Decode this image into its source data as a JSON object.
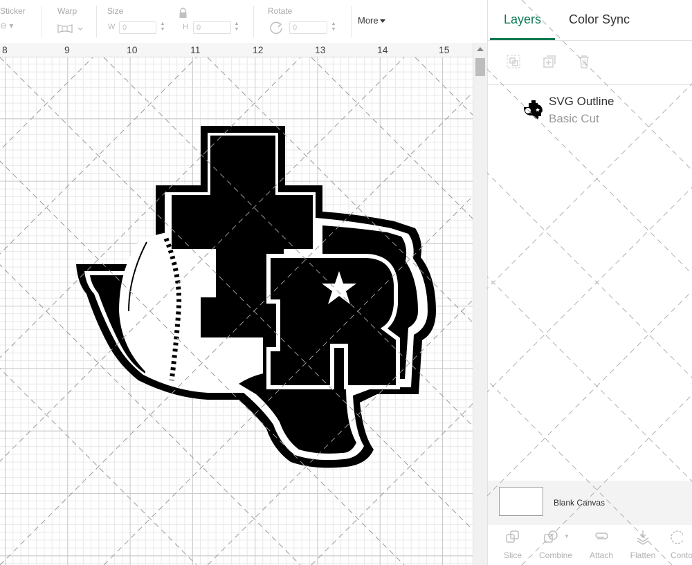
{
  "toolbar": {
    "sticker_label": "Sticker",
    "warp_label": "Warp",
    "size_label": "Size",
    "w_label": "W",
    "h_label": "H",
    "w_value": "0",
    "h_value": "0",
    "rotate_label": "Rotate",
    "rotate_value": "0",
    "more_label": "More"
  },
  "ruler": {
    "ticks": [
      "8",
      "9",
      "10",
      "11",
      "12",
      "13",
      "14",
      "15"
    ]
  },
  "panel": {
    "tabs": [
      {
        "label": "Layers",
        "active": true
      },
      {
        "label": "Color Sync",
        "active": false
      }
    ],
    "layer_actions": [
      {
        "icon": "group-icon"
      },
      {
        "icon": "duplicate-icon"
      },
      {
        "icon": "delete-icon"
      }
    ],
    "layers": [
      {
        "title": "SVG Outline",
        "subtitle": "Basic Cut"
      }
    ],
    "blank_canvas_label": "Blank Canvas",
    "bottom_tools": [
      {
        "label": "Slice",
        "icon": "slice-icon"
      },
      {
        "label": "Combine",
        "icon": "combine-icon"
      },
      {
        "label": "Attach",
        "icon": "attach-icon"
      },
      {
        "label": "Flatten",
        "icon": "flatten-icon"
      },
      {
        "label": "Conto",
        "icon": "contour-icon"
      }
    ]
  },
  "colors": {
    "accent": "#0b7a52",
    "design": "#000000"
  }
}
